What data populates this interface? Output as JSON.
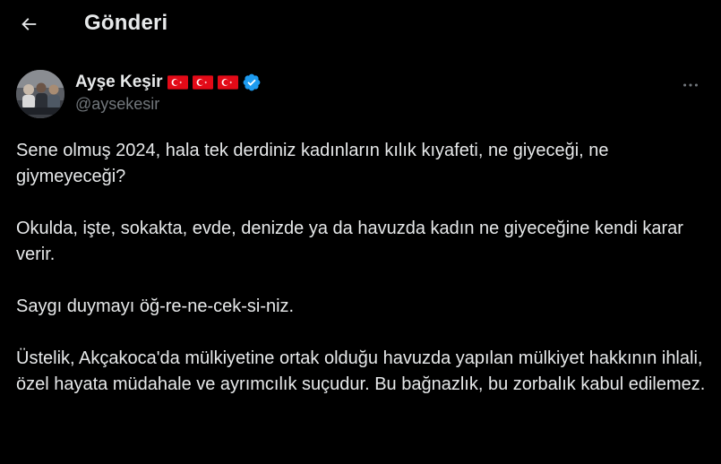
{
  "header": {
    "title": "Gönderi",
    "back_icon": "arrow-left-icon"
  },
  "author": {
    "display_name": "Ayşe Keşir",
    "handle": "@aysekesir",
    "flags": [
      "turkey-flag-icon",
      "turkey-flag-icon",
      "turkey-flag-icon"
    ],
    "verified_icon": "verified-badge-icon",
    "verified_color": "#1d9bf0",
    "more_icon": "more-horizontal-icon"
  },
  "tweet": {
    "paragraphs": [
      "Sene olmuş 2024, hala tek derdiniz kadınların kılık kıyafeti, ne giyeceği, ne giymeyeceği?",
      "Okulda, işte, sokakta, evde, denizde ya da havuzda kadın ne giyeceğine kendi karar verir.",
      "Saygı duymayı öğ-re-ne-cek-si-niz.",
      "Üstelik, Akçakoca'da mülkiyetine ortak olduğu havuzda yapılan mülkiyet hakkının ihlali, özel hayata müdahale ve ayrımcılık suçudur. Bu bağnazlık, bu zorbalık kabul edilemez."
    ]
  },
  "colors": {
    "background": "#000000",
    "text_primary": "#e7e9ea",
    "text_secondary": "#71767b",
    "flag_red": "#e30a17"
  }
}
